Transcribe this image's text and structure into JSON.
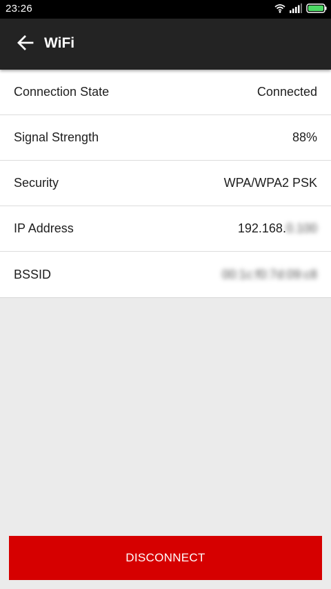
{
  "status_bar": {
    "time": "23:26",
    "icons": [
      "wifi-icon",
      "signal-icon",
      "battery-icon"
    ]
  },
  "app_bar": {
    "title": "WiFi",
    "back_icon": "arrow-left-icon"
  },
  "rows": [
    {
      "label": "Connection State",
      "value": "Connected"
    },
    {
      "label": "Signal Strength",
      "value": "88%"
    },
    {
      "label": "Security",
      "value": "WPA/WPA2 PSK"
    },
    {
      "label": "IP Address",
      "value": "192.168.",
      "value_hidden": "0.100"
    },
    {
      "label": "BSSID",
      "value": "",
      "value_hidden": "00:1c:f0:7d:09:c8"
    }
  ],
  "disconnect_button": {
    "label": "DISCONNECT"
  },
  "colors": {
    "status_bar_bg": "#000000",
    "app_bar_bg": "#232323",
    "accent_red": "#d60000",
    "background": "#ebebeb",
    "battery_green": "#4cd964"
  }
}
